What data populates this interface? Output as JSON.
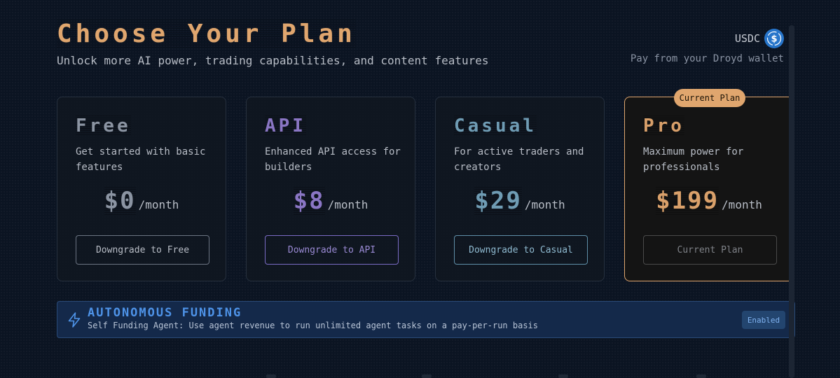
{
  "header": {
    "title": "Choose Your Plan",
    "subtitle": "Unlock more AI power, trading capabilities, and content features",
    "currency_label": "USDC",
    "currency_icon": "usdc-dollar-icon",
    "wallet_note": "Pay from your Droyd wallet"
  },
  "plans": [
    {
      "name": "Free",
      "description": "Get started with basic features",
      "price": "$0",
      "period": "/month",
      "action_label": "Downgrade to Free",
      "color": "#8b94a2",
      "button_border": "#6b7482",
      "button_text": "#b8bdc6"
    },
    {
      "name": "API",
      "description": "Enhanced API access for builders",
      "price": "$8",
      "period": "/month",
      "action_label": "Downgrade to API",
      "color": "#8a76c4",
      "button_border": "#7a6bc4",
      "button_text": "#9a8ad4"
    },
    {
      "name": "Casual",
      "description": "For active traders and creators",
      "price": "$29",
      "period": "/month",
      "action_label": "Downgrade to Casual",
      "color": "#6f9cb4",
      "button_border": "#5f8fa8",
      "button_text": "#8fbad0"
    },
    {
      "name": "Pro",
      "description": "Maximum power for professionals",
      "price": "$199",
      "period": "/month",
      "action_label": "Current Plan",
      "badge": "Current Plan",
      "color": "#d9a06a",
      "button_border": "#4a4a4a",
      "button_text": "#7f8288"
    }
  ],
  "funding": {
    "icon": "lightning-bolt-icon",
    "title": "AUTONOMOUS FUNDING",
    "description": "Self Funding Agent: Use agent revenue to run unlimited agent tasks on a pay-per-run basis",
    "status": "Enabled"
  }
}
